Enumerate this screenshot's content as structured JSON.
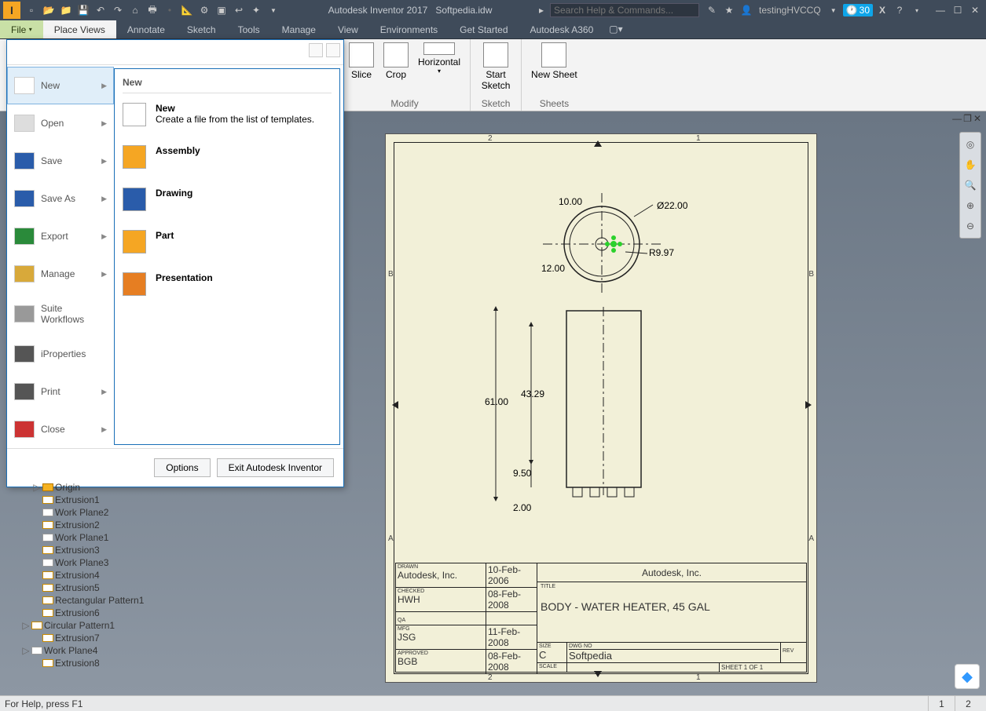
{
  "titlebar": {
    "app": "Autodesk Inventor 2017",
    "doc": "Softpedia.idw",
    "search_placeholder": "Search Help & Commands...",
    "user": "testingHVCCQ",
    "trial_badge": "30"
  },
  "menubar": {
    "file": "File",
    "tabs": [
      "Place Views",
      "Annotate",
      "Sketch",
      "Tools",
      "Manage",
      "View",
      "Environments",
      "Get Started",
      "Autodesk A360"
    ]
  },
  "ribbon": {
    "modify": {
      "slice": "Slice",
      "crop": "Crop",
      "horizontal": "Horizontal",
      "label": "Modify"
    },
    "sketch": {
      "start": "Start Sketch",
      "label": "Sketch"
    },
    "sheets": {
      "new": "New Sheet",
      "label": "Sheets"
    }
  },
  "filemenu": {
    "leftcol": [
      {
        "label": "New",
        "arrow": true,
        "selected": true
      },
      {
        "label": "Open",
        "arrow": true
      },
      {
        "label": "Save",
        "arrow": true
      },
      {
        "label": "Save As",
        "arrow": true
      },
      {
        "label": "Export",
        "arrow": true
      },
      {
        "label": "Manage",
        "arrow": true
      },
      {
        "label": "Suite Workflows",
        "arrow": false
      },
      {
        "label": "iProperties",
        "arrow": false
      },
      {
        "label": "Print",
        "arrow": true
      },
      {
        "label": "Close",
        "arrow": true
      }
    ],
    "rightcol": {
      "title": "New",
      "items": [
        {
          "name": "New",
          "desc": "Create a file from the list of templates."
        },
        {
          "name": "Assembly",
          "desc": ""
        },
        {
          "name": "Drawing",
          "desc": ""
        },
        {
          "name": "Part",
          "desc": ""
        },
        {
          "name": "Presentation",
          "desc": ""
        }
      ]
    },
    "options": "Options",
    "exit": "Exit Autodesk Inventor"
  },
  "drawing": {
    "dims": {
      "d1": "10.00",
      "d2": "Ø22.00",
      "d3": "12.00",
      "d4": "R9.97",
      "d5": "61.00",
      "d6": "43.29",
      "d7": "9.50",
      "d8": "2.00"
    },
    "zones": {
      "top2": "2",
      "top1": "1",
      "leftB": "B",
      "leftA": "A",
      "rightB": "B",
      "rightA": "A",
      "bot2": "2",
      "bot1": "1"
    },
    "titleblock": {
      "drawn": "DRAWN",
      "drawn_by": "Autodesk, Inc.",
      "drawn_date": "10-Feb-2006",
      "checked": "CHECKED",
      "checked_by": "HWH",
      "checked_date": "08-Feb-2008",
      "qa": "QA",
      "mfg": "MFG",
      "mfg_by": "JSG",
      "mfg_date": "11-Feb-2008",
      "approved": "APPROVED",
      "approved_by": "BGB",
      "approved_date": "08-Feb-2008",
      "company": "Autodesk, Inc.",
      "title_lbl": "TITLE",
      "title": "BODY - WATER HEATER, 45 GAL",
      "size_lbl": "SIZE",
      "size": "C",
      "scale_lbl": "SCALE",
      "dwgno_lbl": "DWG NO",
      "dwgno": "Softpedia",
      "rev_lbl": "REV",
      "sheet": "SHEET 1  OF 1"
    }
  },
  "tree": [
    {
      "indent": 2,
      "exp": "▷",
      "icon": "origin",
      "label": "Origin"
    },
    {
      "indent": 2,
      "exp": "",
      "icon": "ext",
      "label": "Extrusion1"
    },
    {
      "indent": 2,
      "exp": "",
      "icon": "wp",
      "label": "Work Plane2"
    },
    {
      "indent": 2,
      "exp": "",
      "icon": "ext",
      "label": "Extrusion2"
    },
    {
      "indent": 2,
      "exp": "",
      "icon": "wp",
      "label": "Work Plane1"
    },
    {
      "indent": 2,
      "exp": "",
      "icon": "ext",
      "label": "Extrusion3"
    },
    {
      "indent": 2,
      "exp": "",
      "icon": "wp",
      "label": "Work Plane3"
    },
    {
      "indent": 2,
      "exp": "",
      "icon": "ext",
      "label": "Extrusion4"
    },
    {
      "indent": 2,
      "exp": "",
      "icon": "ext",
      "label": "Extrusion5"
    },
    {
      "indent": 2,
      "exp": "",
      "icon": "ext",
      "label": "Rectangular Pattern1"
    },
    {
      "indent": 2,
      "exp": "",
      "icon": "ext",
      "label": "Extrusion6"
    },
    {
      "indent": 1,
      "exp": "▷",
      "icon": "ext",
      "label": "Circular Pattern1"
    },
    {
      "indent": 2,
      "exp": "",
      "icon": "ext",
      "label": "Extrusion7"
    },
    {
      "indent": 1,
      "exp": "▷",
      "icon": "wp",
      "label": "Work Plane4"
    },
    {
      "indent": 2,
      "exp": "",
      "icon": "ext",
      "label": "Extrusion8"
    }
  ],
  "status": {
    "help": "For Help, press F1",
    "pages": [
      "1",
      "2"
    ]
  }
}
